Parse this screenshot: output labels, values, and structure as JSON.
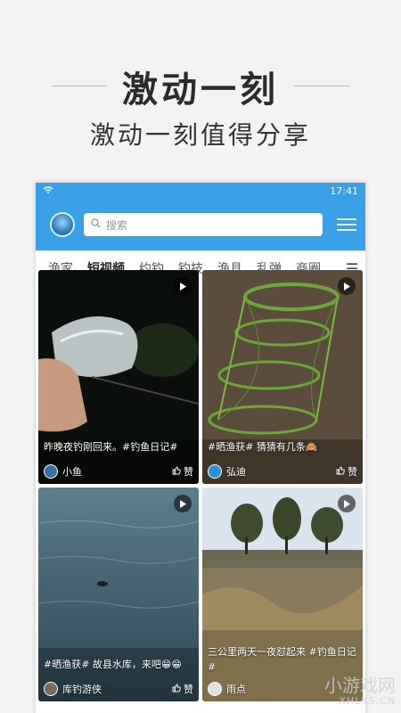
{
  "promo": {
    "title": "激动一刻",
    "subtitle": "激动一刻值得分享"
  },
  "status_bar": {
    "time": "17:41",
    "wifi_icon": "wifi-icon"
  },
  "app_bar": {
    "search_placeholder": "搜索",
    "colors": {
      "primary": "#3aa0e8"
    }
  },
  "tabs": [
    {
      "label": "渔家"
    },
    {
      "label": "短视频",
      "active": true
    },
    {
      "label": "约钓"
    },
    {
      "label": "钓技"
    },
    {
      "label": "渔具"
    },
    {
      "label": "乱弹"
    },
    {
      "label": "商圈"
    }
  ],
  "tab_more_icon": "☰",
  "posts": [
    {
      "caption": "昨晚夜钓刚回来。#钓鱼日记#",
      "user": "小鱼",
      "like_label": "赞"
    },
    {
      "caption": "#晒渔获# 猜猜有几条🙈",
      "user": "弘迪",
      "like_label": "赞"
    },
    {
      "caption": "#晒渔获# 故县水库，来吧😁😁",
      "user": "库钓游侠",
      "like_label": "赞"
    },
    {
      "caption": "三公里两天一夜怼起来 #钓鱼日记#",
      "user": "雨点",
      "like_label": "赞"
    }
  ],
  "watermark": {
    "text": "小游戏网",
    "sub": "XHLKS.CN"
  }
}
